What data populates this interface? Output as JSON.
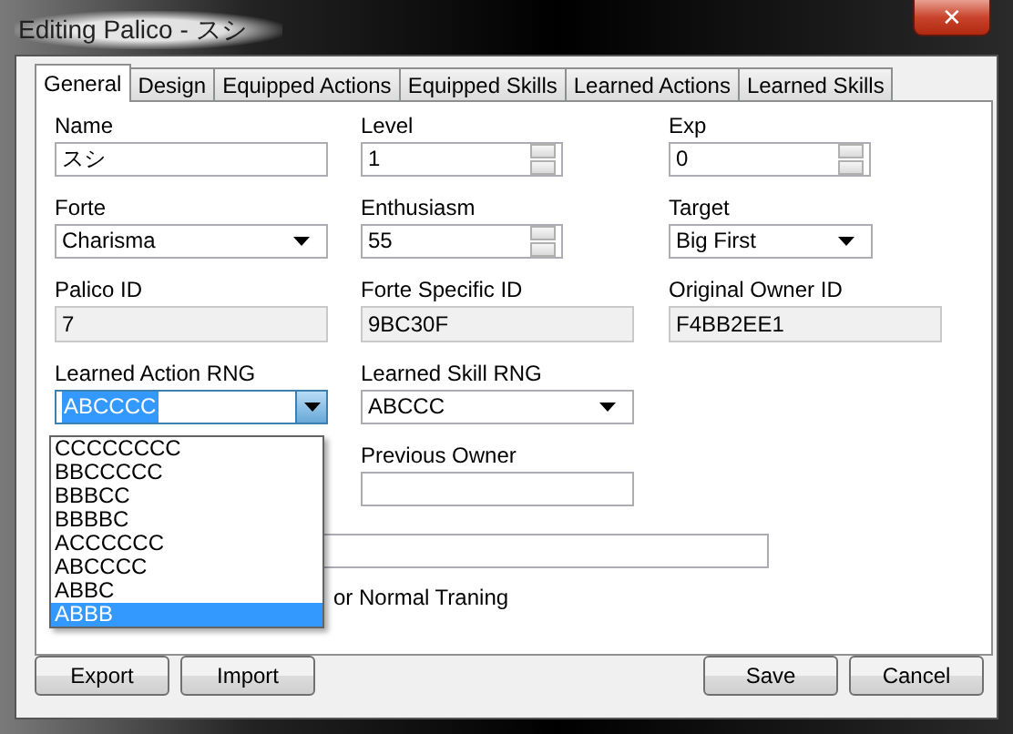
{
  "window": {
    "title": "Editing Palico - スシ",
    "close": "✕"
  },
  "tabs": [
    {
      "label": "General",
      "selected": true
    },
    {
      "label": "Design",
      "selected": false
    },
    {
      "label": "Equipped Actions",
      "selected": false
    },
    {
      "label": "Equipped Skills",
      "selected": false
    },
    {
      "label": "Learned Actions",
      "selected": false
    },
    {
      "label": "Learned Skills",
      "selected": false
    }
  ],
  "rows": [
    [
      {
        "label": "Name",
        "kind": "text",
        "value": "スシ"
      },
      {
        "label": "Level",
        "kind": "spin",
        "value": "1"
      },
      {
        "label": "Exp",
        "kind": "spin",
        "value": "0"
      }
    ],
    [
      {
        "label": "Forte",
        "kind": "select",
        "value": "Charisma"
      },
      {
        "label": "Enthusiasm",
        "kind": "spin",
        "value": "55"
      },
      {
        "label": "Target",
        "kind": "select",
        "value": "Big First"
      }
    ],
    [
      {
        "label": "Palico ID",
        "kind": "readonly",
        "value": "7"
      },
      {
        "label": "Forte Specific ID",
        "kind": "readonly",
        "value": "9BC30F"
      },
      {
        "label": "Original Owner ID",
        "kind": "readonly",
        "value": "F4BB2EE1"
      }
    ],
    [
      {
        "label": "Learned Action RNG",
        "kind": "combo",
        "value": "ABCCCC"
      },
      {
        "label": "Learned Skill RNG",
        "kind": "select",
        "value": "ABCCC"
      },
      null
    ],
    [
      null,
      {
        "label": "Previous Owner",
        "kind": "text"
      },
      null
    ]
  ],
  "dropdown": [
    {
      "label": "CCCCCCCC",
      "selected": false
    },
    {
      "label": "BBCCCCC",
      "selected": false
    },
    {
      "label": "BBBCC",
      "selected": false
    },
    {
      "label": "BBBBC",
      "selected": false
    },
    {
      "label": "ACCCCCC",
      "selected": false
    },
    {
      "label": "ABCCCC",
      "selected": false
    },
    {
      "label": "ABBC",
      "selected": false
    },
    {
      "label": "ABBB",
      "selected": true
    }
  ],
  "checkbox_text": "or Normal Traning",
  "buttons_left": [
    "Export",
    "Import"
  ],
  "buttons_right": [
    "Save",
    "Cancel"
  ]
}
